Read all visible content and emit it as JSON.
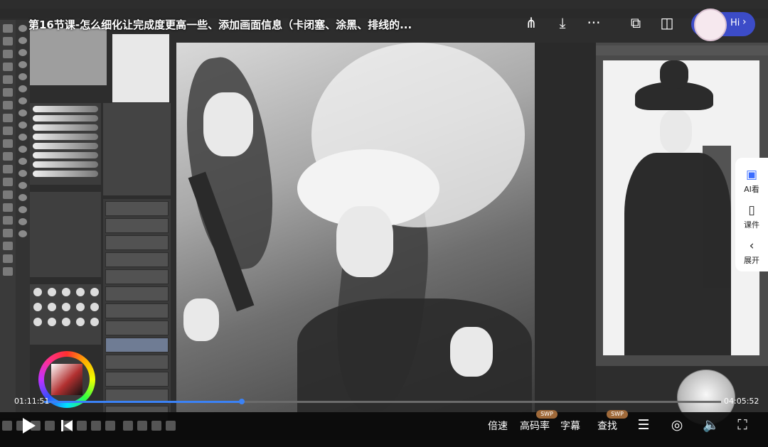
{
  "video": {
    "title": "第16节课-怎么细化让完成度更高一些、添加画面信息（卡闭塞、涂黑、排线的..."
  },
  "top_controls": {
    "share_icon": "share-icon",
    "download_icon": "download-icon",
    "more_icon": "more-icon",
    "screenshot_icon": "screenshot-icon",
    "pip_icon": "pip-icon",
    "assistant_label": "Hi"
  },
  "side_panel": {
    "items": [
      {
        "label": "AI看",
        "icon": "ai-icon"
      },
      {
        "label": "课件",
        "icon": "courseware-icon"
      },
      {
        "label": "展开",
        "icon": "chevron-left-icon"
      }
    ]
  },
  "progress": {
    "current_time": "01:11:51",
    "total_time": "04:05:52",
    "fraction": 0.292
  },
  "controls": {
    "speed_label": "倍速",
    "quality_label": "高码率",
    "quality_badge": "SWP",
    "subtitle_label": "字幕",
    "search_label": "查找",
    "search_badge": "SWP"
  },
  "colors": {
    "progress": "#3b82f6",
    "badge": "#a06a3a",
    "assistant": "#3c4cc8"
  }
}
